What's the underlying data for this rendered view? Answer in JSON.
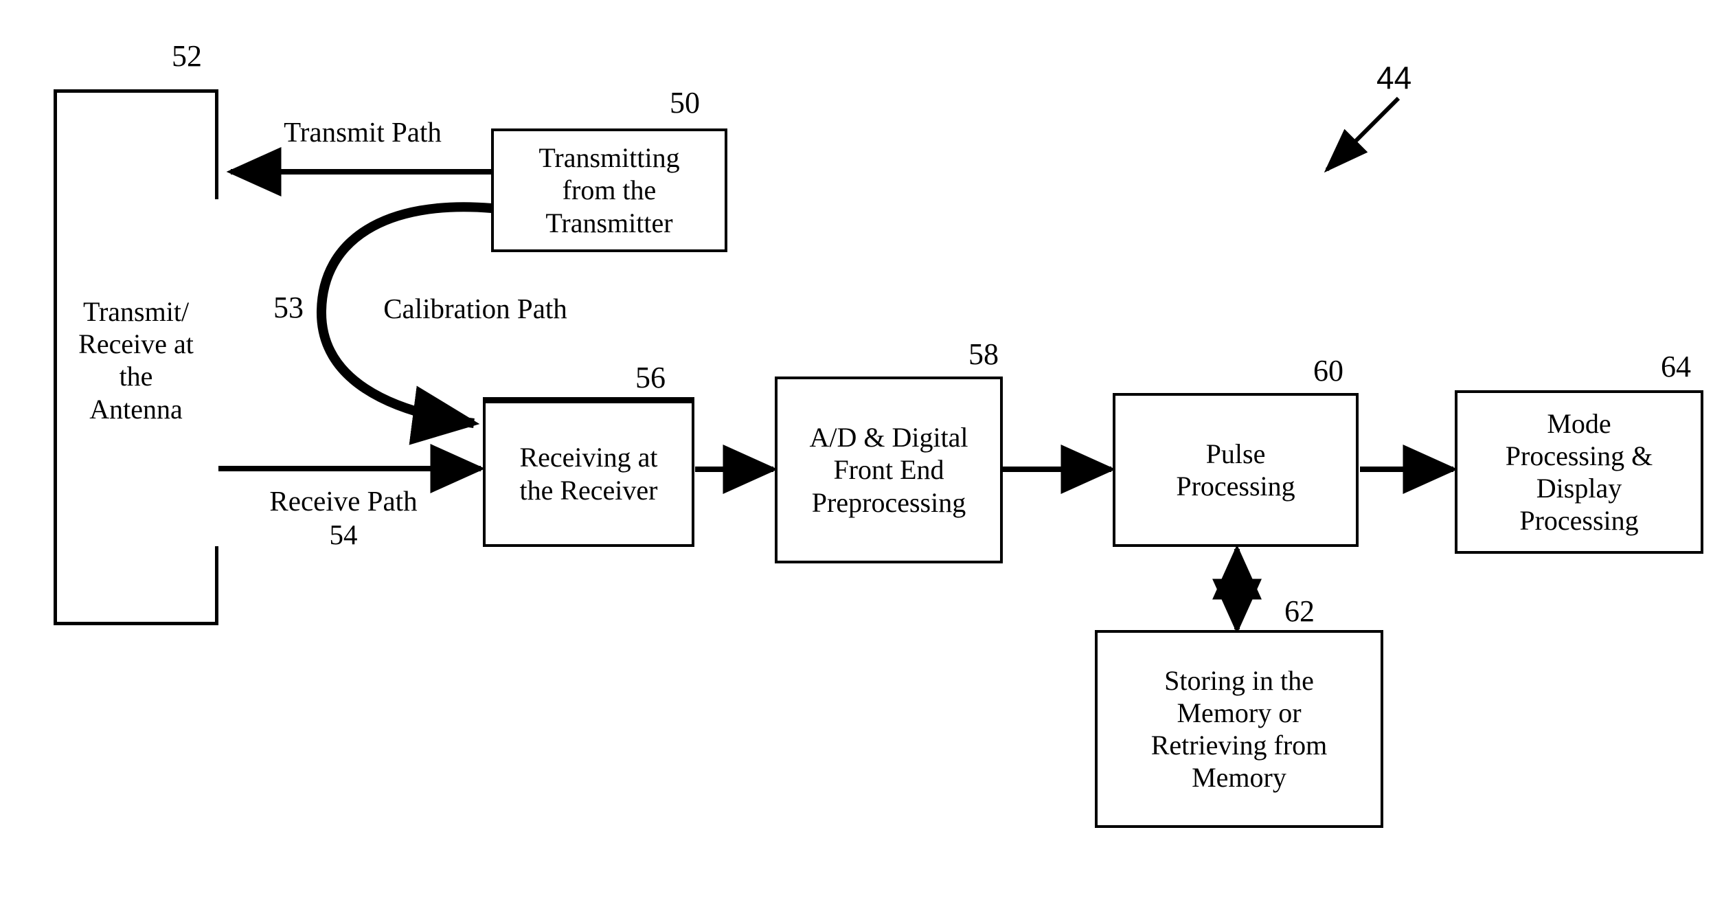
{
  "figure": {
    "title_ref": "44",
    "type": "radar-signal-flow-block-diagram"
  },
  "nodes": [
    {
      "id": "antenna",
      "ref": "52",
      "label": "Transmit/\nReceive at\nthe\nAntenna"
    },
    {
      "id": "transmitter",
      "ref": "50",
      "label": "Transmitting\nfrom the\nTransmitter"
    },
    {
      "id": "receiver",
      "ref": "56",
      "label": "Receiving at\nthe Receiver"
    },
    {
      "id": "adc",
      "ref": "58",
      "label": "A/D & Digital\nFront End\nPreprocessing"
    },
    {
      "id": "pulse",
      "ref": "60",
      "label": "Pulse\nProcessing"
    },
    {
      "id": "memory",
      "ref": "62",
      "label": "Storing in the\nMemory or\nRetrieving from\nMemory"
    },
    {
      "id": "mode",
      "ref": "64",
      "label": "Mode\nProcessing &\nDisplay\nProcessing"
    }
  ],
  "paths": [
    {
      "id": "transmit-path",
      "label": "Transmit Path",
      "from": "transmitter",
      "to": "antenna"
    },
    {
      "id": "calibration-path",
      "label": "Calibration  Path",
      "ref": "53",
      "from": "transmitter",
      "to": "receiver"
    },
    {
      "id": "receive-path",
      "label": "Receive Path\n54",
      "from": "antenna",
      "to": "receiver"
    }
  ],
  "colors": {
    "stroke": "#000000",
    "background": "#ffffff"
  }
}
